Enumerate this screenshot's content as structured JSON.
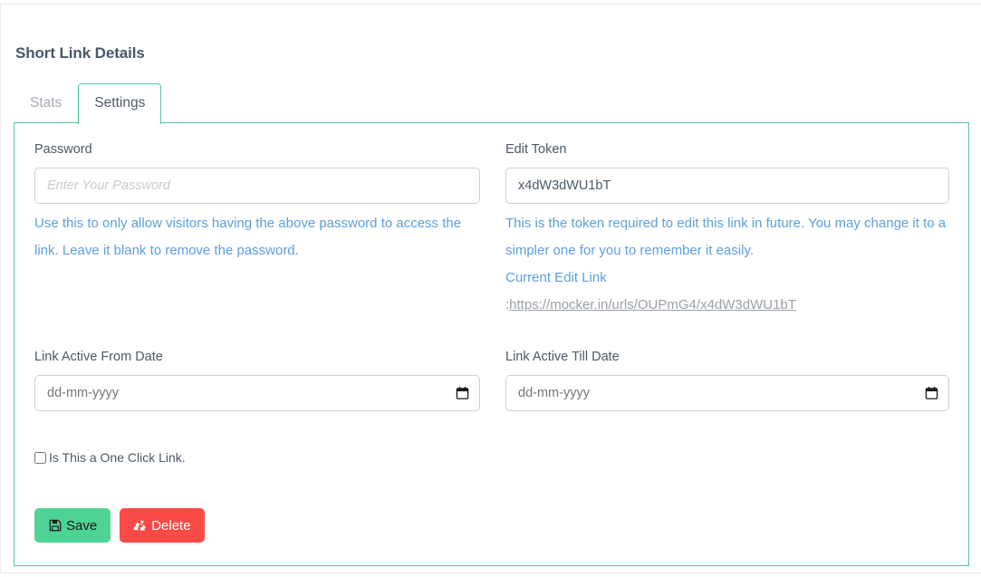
{
  "page": {
    "title": "Short Link Details"
  },
  "tabs": [
    {
      "label": "Stats",
      "active": false
    },
    {
      "label": "Settings",
      "active": true
    }
  ],
  "form": {
    "password": {
      "label": "Password",
      "placeholder": "Enter Your Password",
      "value": "",
      "help": "Use this to only allow visitors having the above password to access the link. Leave it blank to remove the password."
    },
    "edit_token": {
      "label": "Edit Token",
      "placeholder": "",
      "value": "x4dW3dWU1bT",
      "help": "This is the token required to edit this link in future. You may change it to a simpler one for you to remember it easily.",
      "current_edit_link_label": "Current Edit Link",
      "current_edit_link_separator": ":",
      "current_edit_link_url": "https://mocker.in/urls/OUPmG4/x4dW3dWU1bT"
    },
    "active_from": {
      "label": "Link Active From Date",
      "placeholder": "dd-mm-yyyy",
      "value": "",
      "icon": "calendar-icon"
    },
    "active_till": {
      "label": "Link Active Till Date",
      "placeholder": "dd-mm-yyyy",
      "value": "",
      "icon": "calendar-icon"
    },
    "one_click": {
      "label": "Is This a One Click Link.",
      "checked": false
    }
  },
  "actions": {
    "save": {
      "label": "Save",
      "icon": "floppy-disk-icon"
    },
    "delete": {
      "label": "Delete",
      "icon": "recycle-icon"
    }
  },
  "colors": {
    "accent_green": "#4fcc93",
    "save_green": "#4ed394",
    "delete_red": "#fa4a46",
    "help_blue": "#5d9ee0",
    "label_gray": "#4c5966",
    "url_gray": "#9aa0a6"
  }
}
